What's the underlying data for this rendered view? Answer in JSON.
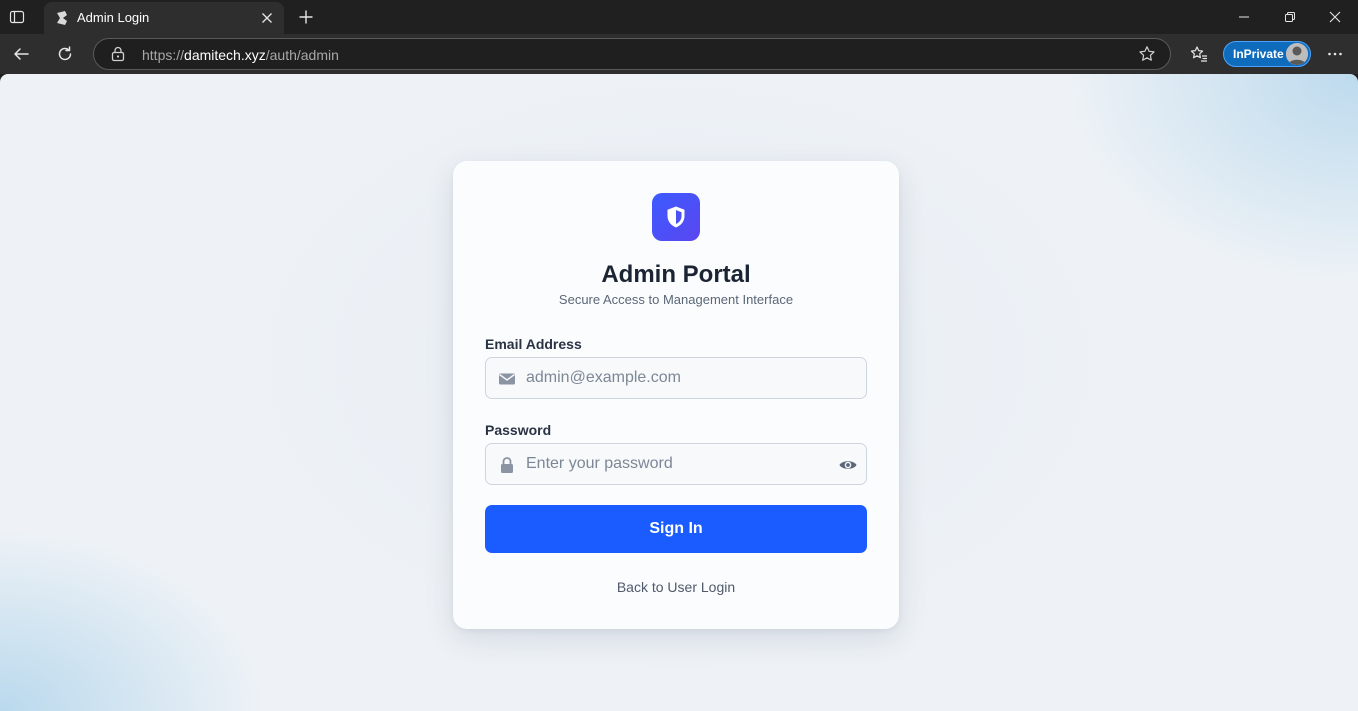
{
  "browser": {
    "tab_title": "Admin Login",
    "url_scheme": "https://",
    "url_host": "damitech.xyz",
    "url_path": "/auth/admin",
    "inprivate_label": "InPrivate"
  },
  "page": {
    "title": "Admin Portal",
    "subtitle": "Secure Access to Management Interface",
    "email_label": "Email Address",
    "email_placeholder": "admin@example.com",
    "email_value": "",
    "password_label": "Password",
    "password_placeholder": "Enter your password",
    "password_value": "",
    "signin_label": "Sign In",
    "back_link": "Back to User Login"
  },
  "colors": {
    "primary_button": "#1a5cff",
    "logo_gradient_start": "#3b5bff",
    "logo_gradient_end": "#5b46f0",
    "inprivate_badge": "#0f6cbd"
  },
  "icons": {
    "logo": "shield-icon",
    "email_field": "envelope-icon",
    "password_field": "lock-icon",
    "password_toggle": "eye-icon"
  }
}
